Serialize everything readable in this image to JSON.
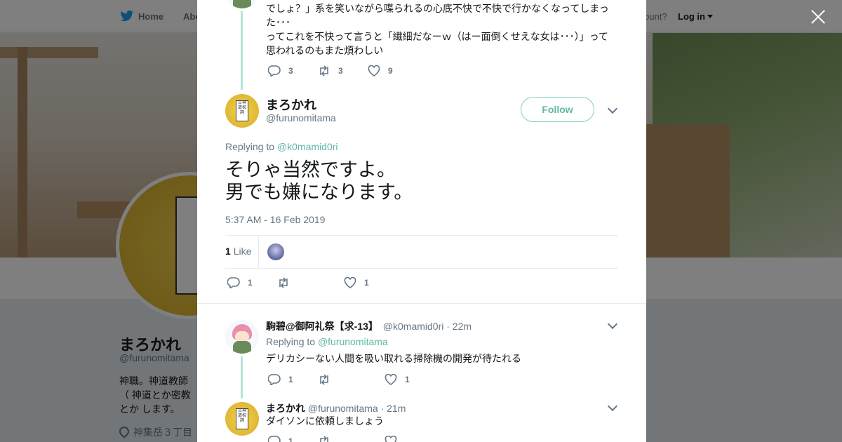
{
  "header": {
    "home_label": "Home",
    "about_label": "Abo",
    "account_label": "ccount?",
    "login_label": "Log in"
  },
  "profile": {
    "name": "まろかれ",
    "handle": "@furunomitama",
    "bio": "神職。神道教師（ 神道とか密教とか します。",
    "location": "神集岳３丁目",
    "avatar_card_text": "古神道祝詞 CDブック"
  },
  "prev_tweet": {
    "text_line1": "でしょ？」系を笑いながら喋られるの心底不快で不快で行かなくなってしまった･･･",
    "text_line2": "ってこれを不快って言うと「繊細だなーｗ（はー面倒くせえな女は･･･）」って思われるのもまた煩わしい",
    "reply_count": "3",
    "retweet_count": "3",
    "like_count": "9"
  },
  "main_tweet": {
    "name": "まろかれ",
    "handle": "@furunomitama",
    "follow_label": "Follow",
    "replying_prefix": "Replying to",
    "replying_handle": "@k0mamid0ri",
    "text_line1": "そりゃ当然ですよ。",
    "text_line2": "男でも嫌になります。",
    "timestamp": "5:37 AM - 16 Feb 2019",
    "likes_count": "1",
    "likes_label": "Like",
    "reply_count": "1",
    "retweet_count": "",
    "like_count": "1",
    "avatar_card_text": "古神道祝詞"
  },
  "replies": [
    {
      "name": "駒碧@御阿礼祭【求-13】",
      "handle": "@k0mamid0ri",
      "time": "· 22m",
      "replying_prefix": "Replying to",
      "replying_handle": "@furunomitama",
      "text": "デリカシーない人間を吸い取れる掃除機の開発が待たれる",
      "reply_count": "1",
      "retweet_count": "",
      "like_count": "1"
    },
    {
      "name": "まろかれ",
      "handle": "@furunomitama",
      "time": "· 21m",
      "text": "ダイソンに依頼しましょう",
      "reply_count": "1",
      "retweet_count": "",
      "like_count": ""
    }
  ],
  "colors": {
    "accent": "#5fb8a5",
    "thread_line": "#b3e6d6",
    "overlay": "rgba(0,0,0,0.5)"
  }
}
